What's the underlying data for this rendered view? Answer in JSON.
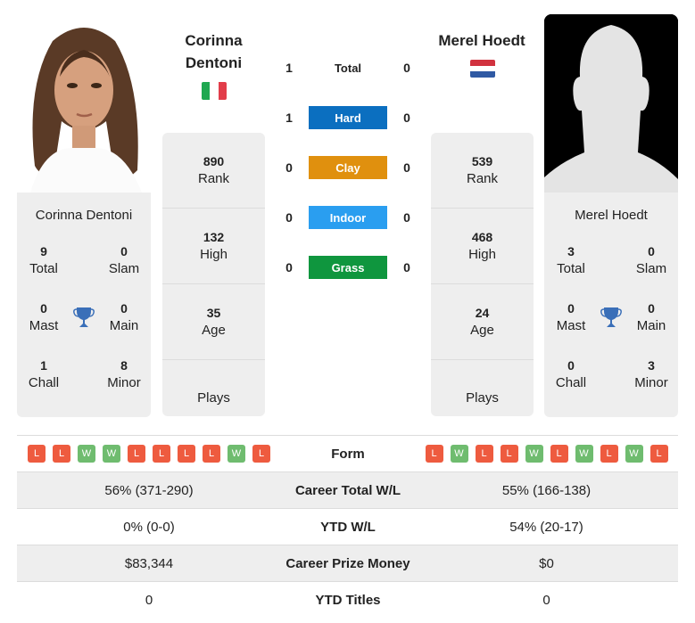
{
  "colors": {
    "hard": "#0b6fc0",
    "clay": "#e0900e",
    "indoor": "#2a9ef0",
    "grass": "#0f963e",
    "loss": "#ee5b3f",
    "win": "#6fbc6f",
    "trophy": "#3a6fb8",
    "card_bg": "#eeeeee"
  },
  "player_left": {
    "name": "Corinna Dentoni",
    "name_line1": "Corinna",
    "name_line2": "Dentoni",
    "country_flag": "italy-flag",
    "rank": "890",
    "rank_label": "Rank",
    "high": "132",
    "high_label": "High",
    "age": "35",
    "age_label": "Age",
    "plays_label": "Plays",
    "titles": {
      "total": "9",
      "total_label": "Total",
      "slam": "0",
      "slam_label": "Slam",
      "mast": "0",
      "mast_label": "Mast",
      "main": "0",
      "main_label": "Main",
      "chall": "1",
      "chall_label": "Chall",
      "minor": "8",
      "minor_label": "Minor"
    },
    "form": [
      "L",
      "L",
      "W",
      "W",
      "L",
      "L",
      "L",
      "L",
      "W",
      "L"
    ]
  },
  "player_right": {
    "name": "Merel Hoedt",
    "country_flag": "netherlands-flag",
    "rank": "539",
    "rank_label": "Rank",
    "high": "468",
    "high_label": "High",
    "age": "24",
    "age_label": "Age",
    "plays_label": "Plays",
    "titles": {
      "total": "3",
      "total_label": "Total",
      "slam": "0",
      "slam_label": "Slam",
      "mast": "0",
      "mast_label": "Mast",
      "main": "0",
      "main_label": "Main",
      "chall": "0",
      "chall_label": "Chall",
      "minor": "3",
      "minor_label": "Minor"
    },
    "form": [
      "L",
      "W",
      "L",
      "L",
      "W",
      "L",
      "W",
      "L",
      "W",
      "L"
    ]
  },
  "h2h": [
    {
      "label": "Total",
      "left": "1",
      "right": "0",
      "surface": "total"
    },
    {
      "label": "Hard",
      "left": "1",
      "right": "0",
      "surface": "hard"
    },
    {
      "label": "Clay",
      "left": "0",
      "right": "0",
      "surface": "clay"
    },
    {
      "label": "Indoor",
      "left": "0",
      "right": "0",
      "surface": "indoor"
    },
    {
      "label": "Grass",
      "left": "0",
      "right": "0",
      "surface": "grass"
    }
  ],
  "table": {
    "form_label": "Form",
    "rows": [
      {
        "label": "Career Total W/L",
        "left": "56% (371-290)",
        "right": "55% (166-138)"
      },
      {
        "label": "YTD W/L",
        "left": "0% (0-0)",
        "right": "54% (20-17)"
      },
      {
        "label": "Career Prize Money",
        "left": "$83,344",
        "right": "$0"
      },
      {
        "label": "YTD Titles",
        "left": "0",
        "right": "0"
      }
    ]
  }
}
